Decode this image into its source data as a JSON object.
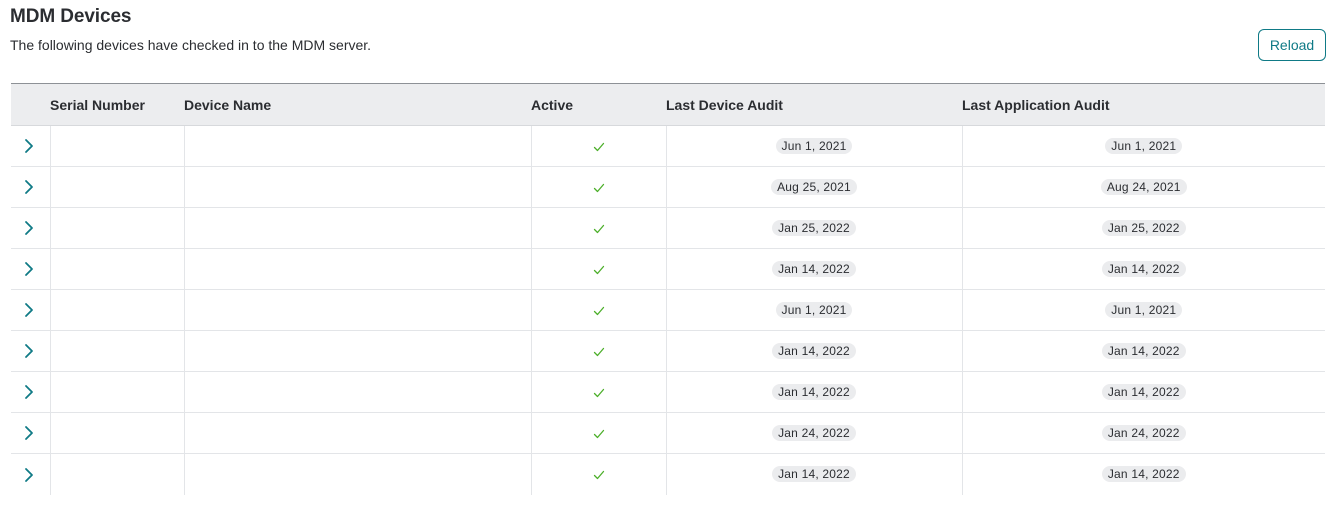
{
  "header": {
    "title": "MDM Devices",
    "subtitle": "The following devices have checked in to the MDM server.",
    "reload_label": "Reload"
  },
  "table": {
    "columns": {
      "serial": "Serial Number",
      "name": "Device Name",
      "active": "Active",
      "device_audit": "Last Device Audit",
      "app_audit": "Last Application Audit"
    },
    "rows": [
      {
        "serial": "",
        "name": "",
        "active": true,
        "device_audit": "Jun 1, 2021",
        "app_audit": "Jun 1, 2021"
      },
      {
        "serial": "",
        "name": "",
        "active": true,
        "device_audit": "Aug 25, 2021",
        "app_audit": "Aug 24, 2021"
      },
      {
        "serial": "",
        "name": "",
        "active": true,
        "device_audit": "Jan 25, 2022",
        "app_audit": "Jan 25, 2022"
      },
      {
        "serial": "",
        "name": "",
        "active": true,
        "device_audit": "Jan 14, 2022",
        "app_audit": "Jan 14, 2022"
      },
      {
        "serial": "",
        "name": "",
        "active": true,
        "device_audit": "Jun 1, 2021",
        "app_audit": "Jun 1, 2021"
      },
      {
        "serial": "",
        "name": "",
        "active": true,
        "device_audit": "Jan 14, 2022",
        "app_audit": "Jan 14, 2022"
      },
      {
        "serial": "",
        "name": "",
        "active": true,
        "device_audit": "Jan 14, 2022",
        "app_audit": "Jan 14, 2022"
      },
      {
        "serial": "",
        "name": "",
        "active": true,
        "device_audit": "Jan 24, 2022",
        "app_audit": "Jan 24, 2022"
      },
      {
        "serial": "",
        "name": "",
        "active": true,
        "device_audit": "Jan 14, 2022",
        "app_audit": "Jan 14, 2022"
      }
    ]
  },
  "icons": {
    "expand": "chevron-right-icon",
    "active": "checkmark-icon"
  },
  "colors": {
    "accent": "#0f7a86",
    "check": "#4caf2a",
    "header_bg": "#ecedef",
    "pill_bg": "#ebecee"
  }
}
